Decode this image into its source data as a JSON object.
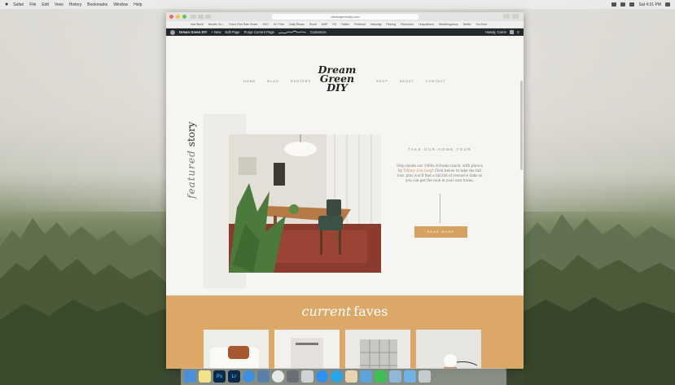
{
  "menubar": {
    "items": [
      "Safari",
      "File",
      "Edit",
      "View",
      "History",
      "Bookmarks",
      "Window",
      "Help"
    ],
    "clock": "Sat 4:31 PM"
  },
  "browser": {
    "url": "dreamgreendiy.com",
    "bookmarks": [
      "Add Bkmk",
      "Bundle Gu...",
      "Dan's Film Rate Sheet",
      "SEO",
      "DIY Film",
      "Daily Reads",
      "Email",
      "AMP",
      "FB",
      "Twitter",
      "Pinterest",
      "Hellodigi",
      "Pinning",
      "Pinboards",
      "Linkpatterns",
      "Weathergranny",
      "Netflix",
      "YouTube"
    ]
  },
  "adminbar": {
    "site_name": "Dream Green DIY",
    "new_label": "+ New",
    "edit_label": "Edit Page",
    "purge_label": "Purge Current Page",
    "customize_label": "Customize",
    "howdy": "Howdy, Carrie"
  },
  "site": {
    "nav_left": [
      "HOME",
      "BLOG",
      "RENTERS"
    ],
    "nav_right": [
      "SHOP",
      "ABOUT",
      "CONTACT"
    ],
    "logo_line1": "Dream",
    "logo_line2": "Green",
    "logo_line3": "DIY",
    "featured_italic": "featured",
    "featured_word": "story",
    "tour_title": "TAKE OUR HOME TOUR",
    "tour_text_before": "Step inside our 1960s A-frame ranch, with photos by",
    "tour_text_photographer": "Tiffany Sun Jung",
    "tour_text_after": "! Click below to take the full tour, plus you'll find a full list of resource links so you can get the look in your own home.",
    "read_more": "READ MORE",
    "faves_italic": "current",
    "faves_word": "faves"
  },
  "colors": {
    "accent": "#d5a25f",
    "faves_bg": "#dba868",
    "adminbar": "#23282d"
  },
  "dock": {
    "icons": [
      "finder-icon",
      "notes-icon",
      "photoshop-icon",
      "lightroom-icon",
      "safari-icon",
      "preview-icon",
      "itunes-icon",
      "launchpad-icon",
      "script-icon",
      "app-store-icon",
      "skype-icon",
      "lightbox-icon",
      "sketch-icon",
      "messages-icon",
      "photos-icon",
      "folder-icon",
      "trash-icon"
    ],
    "ps_label": "Ps",
    "lr_label": "Lr"
  }
}
